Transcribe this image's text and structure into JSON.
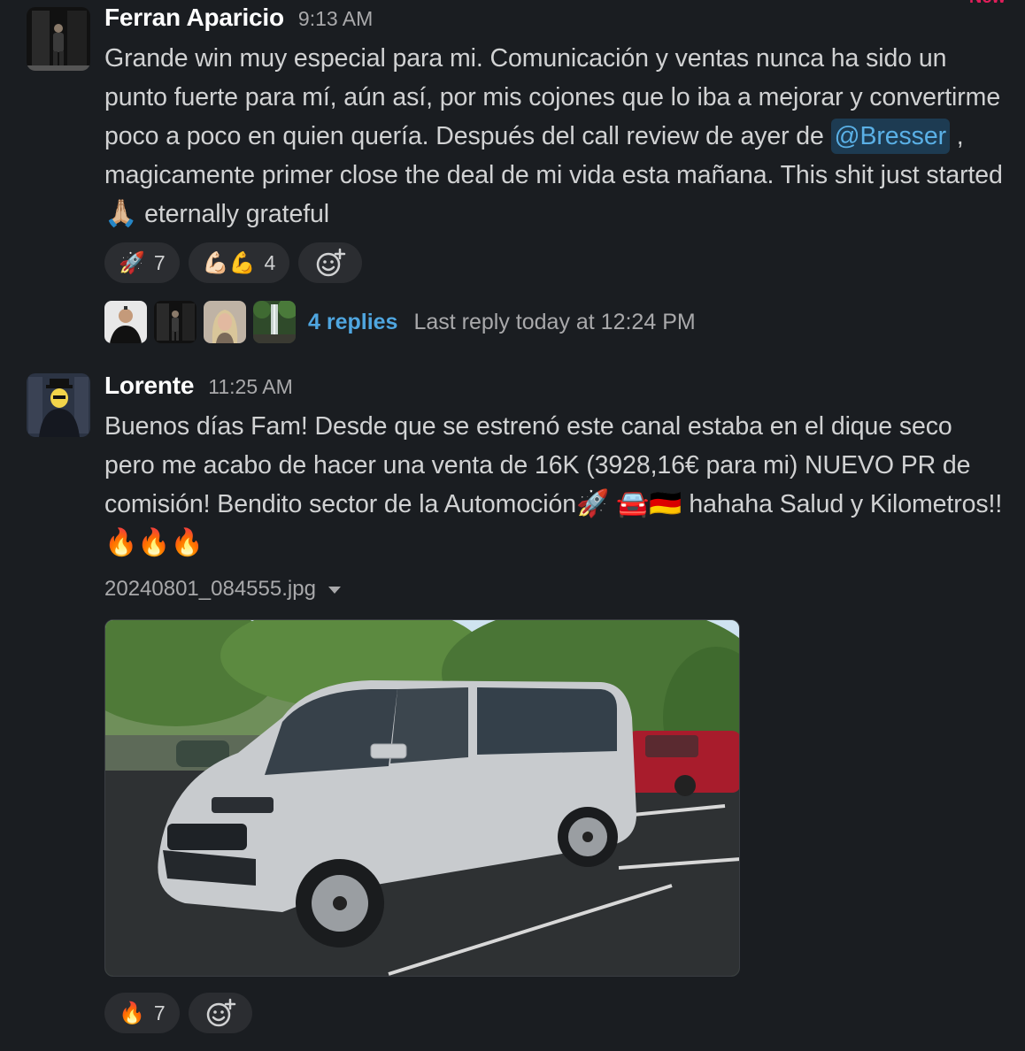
{
  "messages": [
    {
      "username": "Ferran Aparicio",
      "time": "9:13 AM",
      "text_part1": "Grande win muy especial para mi. Comunicación y ventas nunca ha sido un punto fuerte para mí, aún así, por mis cojones que lo iba a mejorar y convertirme poco a poco en quien quería. Después del call review de ayer de",
      "mention": "@Bresser",
      "text_part2": ", magicamente primer close the deal de mi vida esta mañana. This shit just started",
      "emoji_inline": "🙏🏼",
      "text_part3": "eternally grateful",
      "reactions": [
        {
          "emoji": "🚀",
          "count": "7",
          "icon": "rocket-icon"
        },
        {
          "emoji": "💪🏻💪",
          "count": "4",
          "icon": "flexed-biceps-icon"
        }
      ],
      "thread": {
        "replies": "4 replies",
        "last_reply": "Last reply today at 12:24 PM"
      }
    },
    {
      "username": "Lorente",
      "time": "11:25 AM",
      "text_part1": "Buenos días Fam! Desde que se estrenó este canal estaba en el dique seco pero me acabo de hacer una venta de 16K (3928,16€ para mi) NUEVO PR de comisión! Bendito sector de la Automoción",
      "emoji_a": "🚀",
      "emoji_b": "🚘🇩🇪",
      "text_part2": "hahaha Salud y Kilometros!!",
      "emoji_c": "🔥🔥🔥",
      "file_name": "20240801_084555.jpg",
      "reactions": [
        {
          "emoji": "🔥",
          "count": "7",
          "icon": "fire-icon"
        }
      ]
    }
  ],
  "colors": {
    "background": "#1a1d21",
    "mention_bg": "#1d3b52",
    "link": "#4fa6e0",
    "new_flag": "#e01e5a"
  }
}
